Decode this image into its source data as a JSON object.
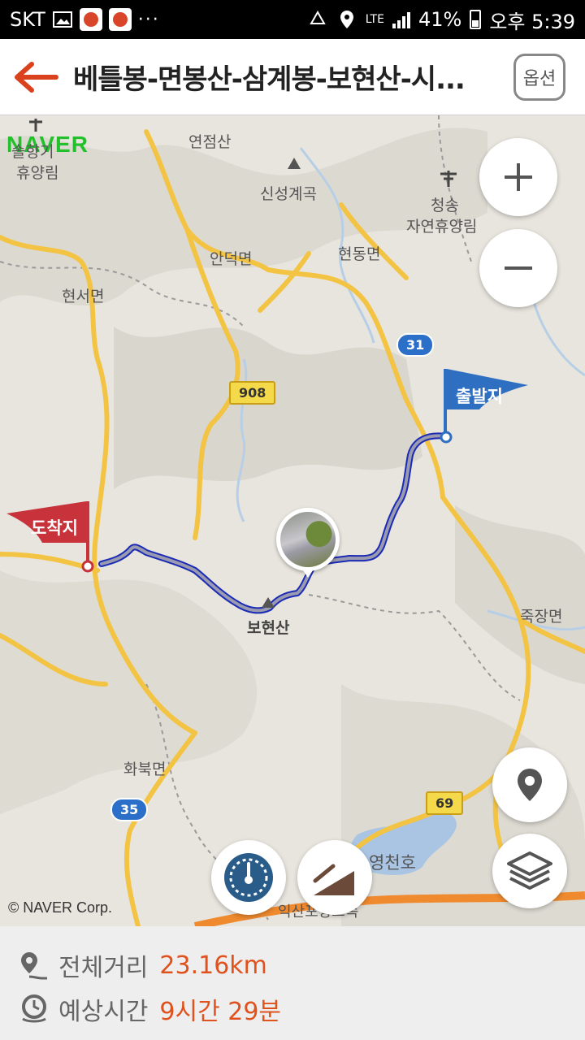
{
  "status_bar": {
    "carrier": "SKT",
    "network": "LTE",
    "battery": "41%",
    "time": "오후 5:39"
  },
  "header": {
    "title": "베틀봉-면봉산-삼계봉-보현산-시...",
    "options_label": "옵션"
  },
  "map": {
    "provider_logo": "NAVER",
    "copyright": "© NAVER Corp.",
    "labels": {
      "yeonjeomsan": "연점산",
      "singseonggyegok": "신성계곡",
      "cheongsong": "청송",
      "cheongsong_forest": "자연휴양림",
      "andeokmyeon": "안덕면",
      "hyeondongmyeon": "현동면",
      "hyeonseomyeon": "현서면",
      "forest_top_left_1": "솔향기",
      "forest_top_left_2": "휴양림",
      "bohyeonsan": "보현산",
      "jukjangmyeon": "죽장면",
      "hwabukmyeon": "화북면",
      "yeongcheonho": "영천호",
      "highway": "익산포항고속"
    },
    "road_numbers": {
      "r31": "31",
      "r908": "908",
      "r35": "35",
      "r69": "69"
    },
    "start_flag": "출발지",
    "end_flag": "도착지"
  },
  "info": {
    "distance_label": "전체거리",
    "distance_value": "23.16km",
    "time_label": "예상시간",
    "time_value": "9시간 29분"
  },
  "colors": {
    "accent": "#e0521d",
    "route": "#1c2bb5",
    "start_flag": "#2f6fc1",
    "end_flag": "#c8323a",
    "naver_green": "#22c12b"
  }
}
